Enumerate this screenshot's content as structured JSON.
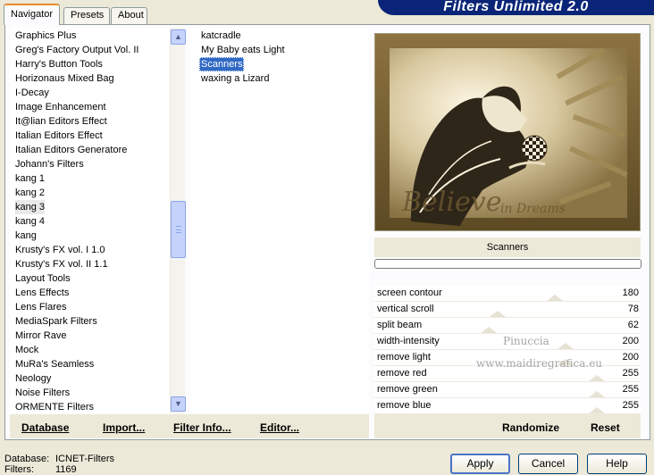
{
  "banner": {
    "title": "Filters Unlimited 2.0"
  },
  "tabs": [
    {
      "label": "Navigator",
      "active": true
    },
    {
      "label": "Presets",
      "active": false
    },
    {
      "label": "About",
      "active": false
    }
  ],
  "categories": {
    "selected": "kang 3",
    "items": [
      "Graphics Plus",
      "Greg's Factory Output Vol. II",
      "Harry's Button Tools",
      "Horizonaus Mixed Bag",
      "I-Decay",
      "Image Enhancement",
      "It@lian Editors Effect",
      "Italian Editors Effect",
      "Italian Editors Generatore",
      "Johann's Filters",
      "kang 1",
      "kang 2",
      "kang 3",
      "kang 4",
      "kang",
      "Krusty's FX vol. I 1.0",
      "Krusty's FX vol. II 1.1",
      "Layout Tools",
      "Lens Effects",
      "Lens Flares",
      "MediaSpark Filters",
      "Mirror Rave",
      "Mock",
      "MuRa's Seamless",
      "Neology",
      "Noise Filters",
      "ORMENTE Filters"
    ],
    "scroll_up_icon": "chevron-up-icon",
    "scroll_down_icon": "chevron-down-icon",
    "scroll_position": 0.53
  },
  "filters": {
    "selected": "Scanners",
    "items": [
      "katcradle",
      "My Baby eats Light",
      "Scanners",
      "waxing a Lizard"
    ]
  },
  "buttons_left": {
    "database": "Database",
    "import": "Import...",
    "filter_info": "Filter Info...",
    "editor": "Editor..."
  },
  "preview": {
    "filter_name": "Scanners",
    "image_text_big": "Believe",
    "image_text_small": "in Dreams"
  },
  "params": [
    {
      "name": "screen contour",
      "value": "180",
      "level": 0.706
    },
    {
      "name": "vertical scroll",
      "value": "78",
      "level": 0.306
    },
    {
      "name": "split beam",
      "value": "62",
      "level": 0.243
    },
    {
      "name": "width-intensity",
      "value": "200",
      "level": 0.784
    },
    {
      "name": "remove light",
      "value": "200",
      "level": 0.784
    },
    {
      "name": "remove red",
      "value": "255",
      "level": 1.0
    },
    {
      "name": "remove green",
      "value": "255",
      "level": 1.0
    },
    {
      "name": "remove blue",
      "value": "255",
      "level": 1.0
    }
  ],
  "watermark": {
    "line1": "Pinuccia",
    "line2": "www.maidiregrafica.eu"
  },
  "buttons_right": {
    "randomize": "Randomize",
    "reset": "Reset"
  },
  "status": {
    "database_label": "Database:",
    "database_value": "ICNET-Filters",
    "filters_label": "Filters:",
    "filters_value": "1169"
  },
  "dialog_buttons": {
    "apply": "Apply",
    "cancel": "Cancel",
    "help": "Help"
  },
  "colors": {
    "banner": "#0a2577",
    "selection": "#316ac5",
    "tab_accent": "#e68b2c"
  }
}
